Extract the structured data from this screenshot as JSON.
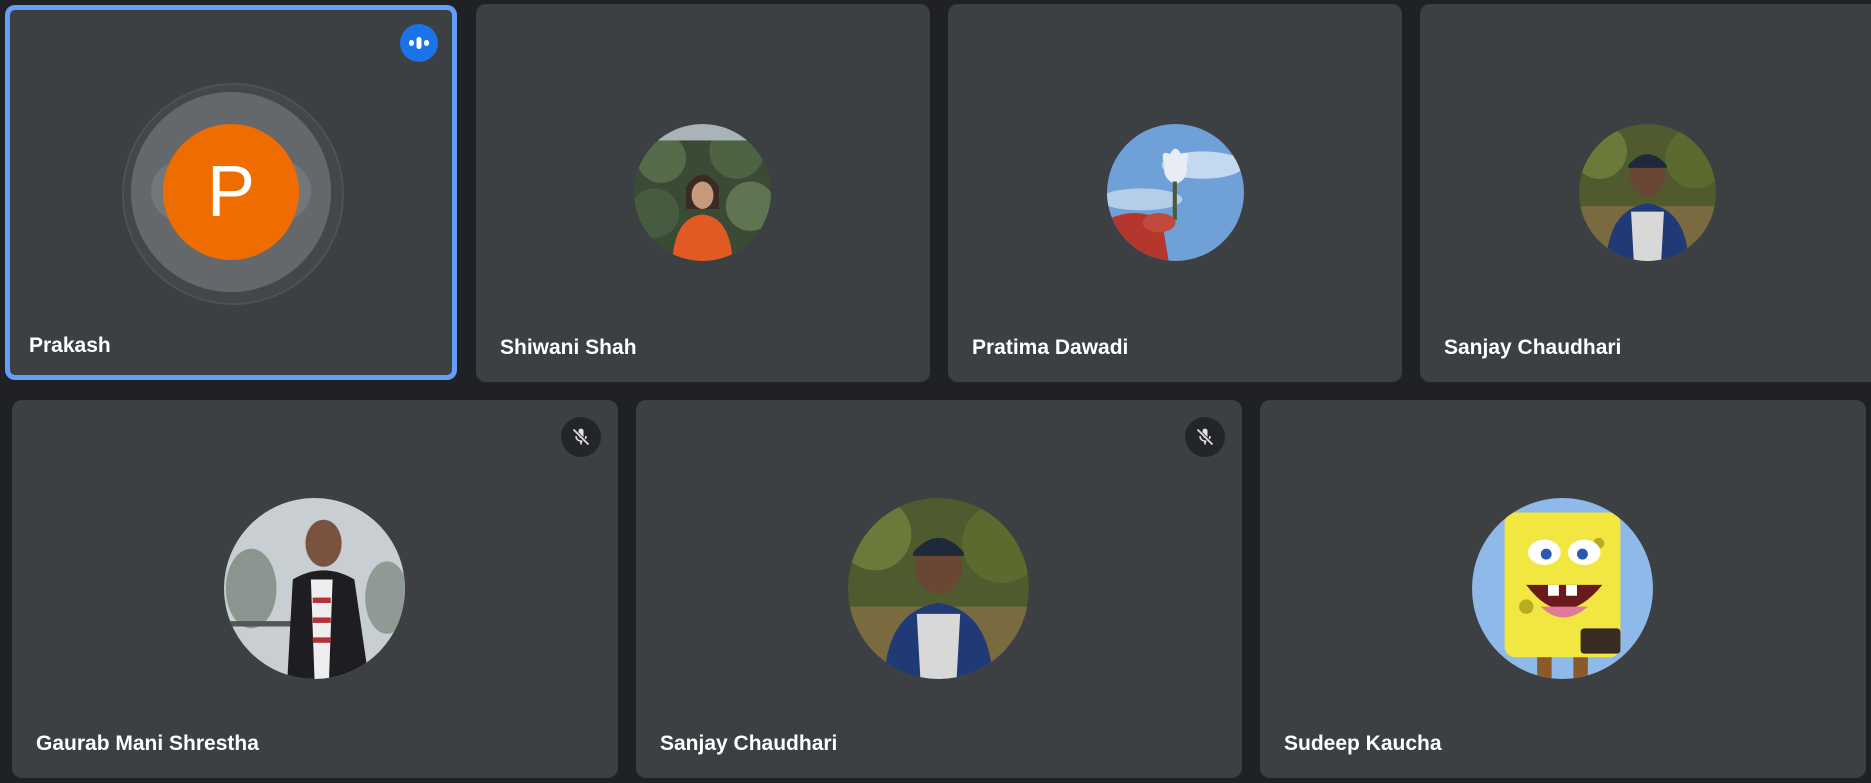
{
  "participants": [
    {
      "name": "Prakash",
      "initial": "P",
      "speaking": true,
      "muted": false,
      "avatar_color": "#ee6c00"
    },
    {
      "name": "Shiwani Shah",
      "speaking": false,
      "muted": false
    },
    {
      "name": "Pratima Dawadi",
      "speaking": false,
      "muted": false
    },
    {
      "name": "Sanjay Chaudhari",
      "speaking": false,
      "muted": false
    },
    {
      "name": "Gaurab Mani Shrestha",
      "speaking": false,
      "muted": true
    },
    {
      "name": "Sanjay Chaudhari",
      "speaking": false,
      "muted": true
    },
    {
      "name": "Sudeep Kaucha",
      "speaking": false,
      "muted": false
    }
  ],
  "icons": {
    "speaking": "audio-level-icon",
    "muted": "mic-off-icon"
  },
  "colors": {
    "background": "#202124",
    "tile": "#3c4043",
    "active_border": "#669df6",
    "speaking_badge": "#1a73e8"
  }
}
